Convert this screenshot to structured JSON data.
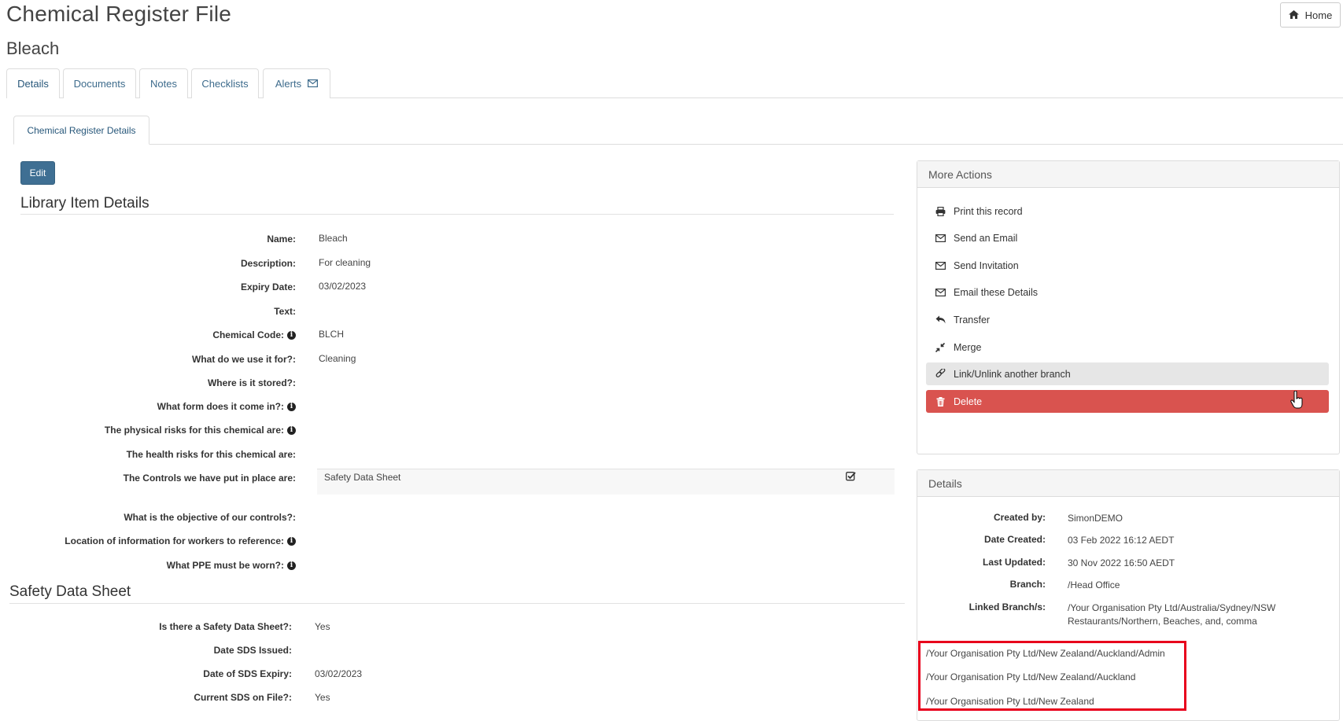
{
  "header": {
    "title": "Chemical Register File",
    "subtitle": "Bleach",
    "home_label": "Home"
  },
  "tabs": [
    {
      "label": "Details",
      "active": true
    },
    {
      "label": "Documents"
    },
    {
      "label": "Notes"
    },
    {
      "label": "Checklists"
    },
    {
      "label": "Alerts",
      "icon": "envelope-icon"
    }
  ],
  "subtab": {
    "label": "Chemical Register Details"
  },
  "edit_label": "Edit",
  "library": {
    "heading": "Library Item Details",
    "fields": [
      {
        "label": "Name:",
        "value": "Bleach"
      },
      {
        "label": "Description:",
        "value": "For cleaning"
      },
      {
        "label": "Expiry Date:",
        "value": "03/02/2023"
      },
      {
        "label": "Text:",
        "value": ""
      },
      {
        "label": "Chemical Code:",
        "value": "BLCH",
        "info": true
      },
      {
        "label": "What do we use it for?:",
        "value": "Cleaning"
      },
      {
        "label": "Where is it stored?:",
        "value": ""
      },
      {
        "label": "What form does it come in?:",
        "value": "",
        "info": true
      },
      {
        "label": "The physical risks for this chemical are:",
        "value": "",
        "info": true
      },
      {
        "label": "The health risks for this chemical are:",
        "value": ""
      },
      {
        "label": "The Controls we have put in place are:",
        "value": "Safety Data Sheet",
        "checked": true
      },
      {
        "label": "What is the objective of our controls?:",
        "value": ""
      },
      {
        "label": "Location of information for workers to reference:",
        "value": "",
        "info": true
      },
      {
        "label": "What PPE must be worn?:",
        "value": "",
        "info": true
      }
    ]
  },
  "sds": {
    "heading": "Safety Data Sheet",
    "fields": [
      {
        "label": "Is there a Safety Data Sheet?:",
        "value": "Yes"
      },
      {
        "label": "Date SDS Issued:",
        "value": ""
      },
      {
        "label": "Date of SDS Expiry:",
        "value": "03/02/2023"
      },
      {
        "label": "Current SDS on File?:",
        "value": "Yes"
      }
    ]
  },
  "more_actions": {
    "title": "More Actions",
    "items": [
      {
        "label": "Print this record",
        "icon": "print-icon"
      },
      {
        "label": "Send an Email",
        "icon": "envelope-icon"
      },
      {
        "label": "Send Invitation",
        "icon": "envelope-icon"
      },
      {
        "label": "Email these Details",
        "icon": "envelope-icon"
      },
      {
        "label": "Transfer",
        "icon": "reply-icon"
      },
      {
        "label": "Merge",
        "icon": "compress-icon"
      },
      {
        "label": "Link/Unlink another branch",
        "icon": "link-icon",
        "state": "hover"
      },
      {
        "label": "Delete",
        "icon": "trash-icon",
        "state": "danger"
      }
    ]
  },
  "details_panel": {
    "title": "Details",
    "rows": [
      {
        "label": "Created by:",
        "value": "SimonDEMO"
      },
      {
        "label": "Date Created:",
        "value": "03 Feb 2022 16:12 AEDT"
      },
      {
        "label": "Last Updated:",
        "value": "30 Nov 2022 16:50 AEDT"
      },
      {
        "label": "Branch:",
        "value": "/Head Office"
      },
      {
        "label": "Linked Branch/s:",
        "value": "/Your Organisation Pty Ltd/Australia/Sydney/NSW Restaurants/Northern, Beaches, and, comma"
      }
    ],
    "linked_extra": [
      "/Your Organisation Pty Ltd/New Zealand/Auckland/Admin",
      "/Your Organisation Pty Ltd/New Zealand/Auckland",
      "/Your Organisation Pty Ltd/New Zealand"
    ]
  },
  "colors": {
    "primary": "#3f6f93",
    "danger": "#d9534f",
    "highlight": "#e8001c",
    "tab_text": "#3d6b8c"
  }
}
